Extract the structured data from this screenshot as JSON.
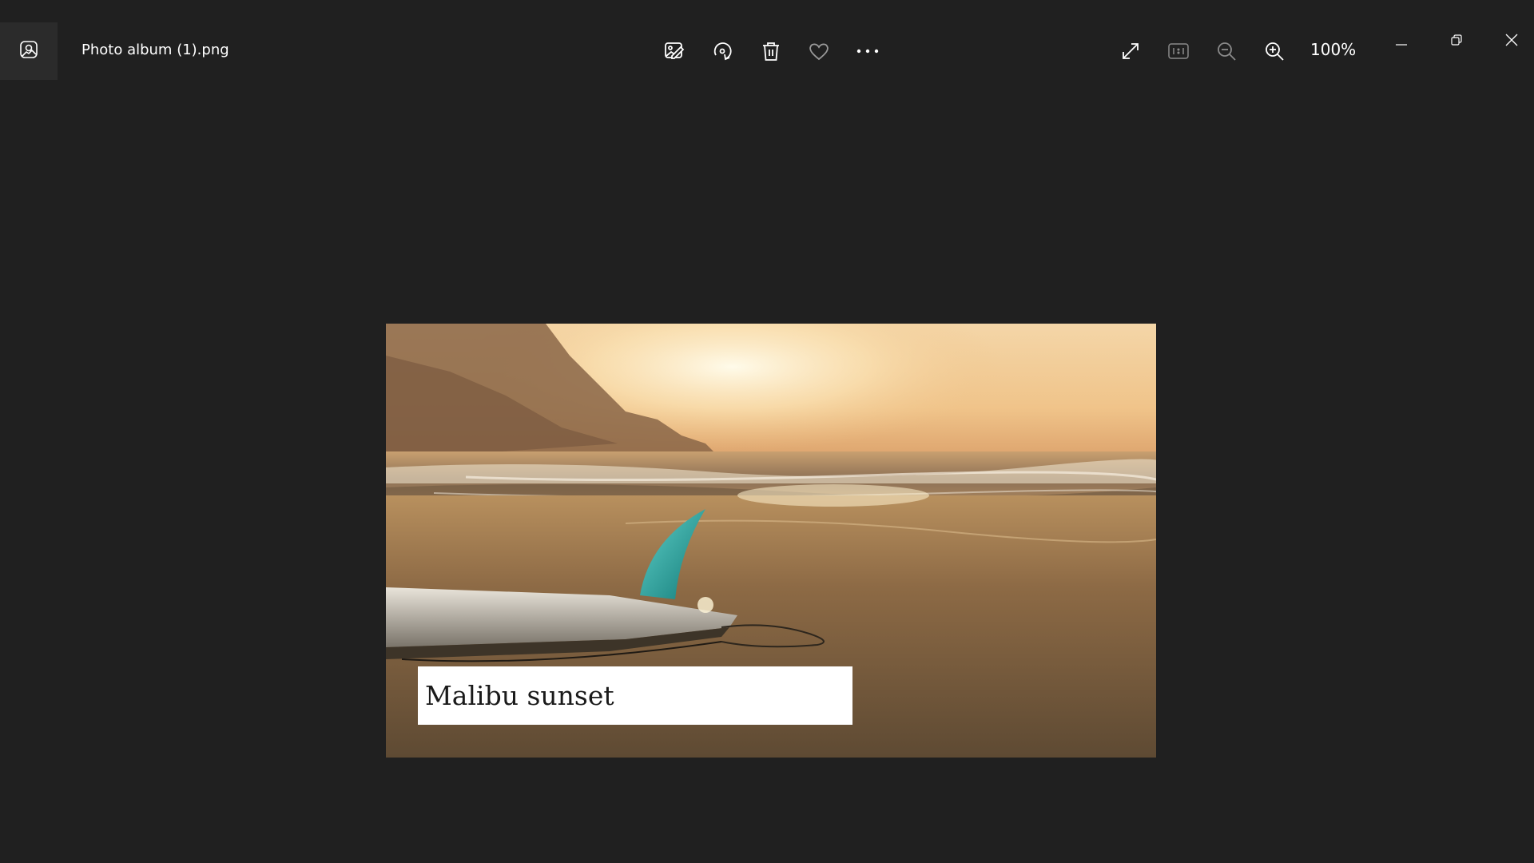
{
  "window": {
    "file_name": "Photo album (1).png",
    "zoom_level": "100%"
  },
  "toolbar": {
    "icons": [
      "edit-image-icon",
      "rotate-icon",
      "trash-icon",
      "heart-icon",
      "more-icon"
    ]
  },
  "zoom_controls": {
    "icons": [
      "expand-icon",
      "actual-size-icon",
      "zoom-out-icon",
      "zoom-in-icon"
    ]
  },
  "window_controls": {
    "icons": [
      "minimize-icon",
      "restore-icon",
      "close-icon"
    ]
  },
  "photo": {
    "caption": "Malibu sunset"
  },
  "colors": {
    "background": "#202020",
    "icon": "#ffffff",
    "icon_disabled": "#8a8a8a",
    "caption_box": "#ffffff"
  }
}
